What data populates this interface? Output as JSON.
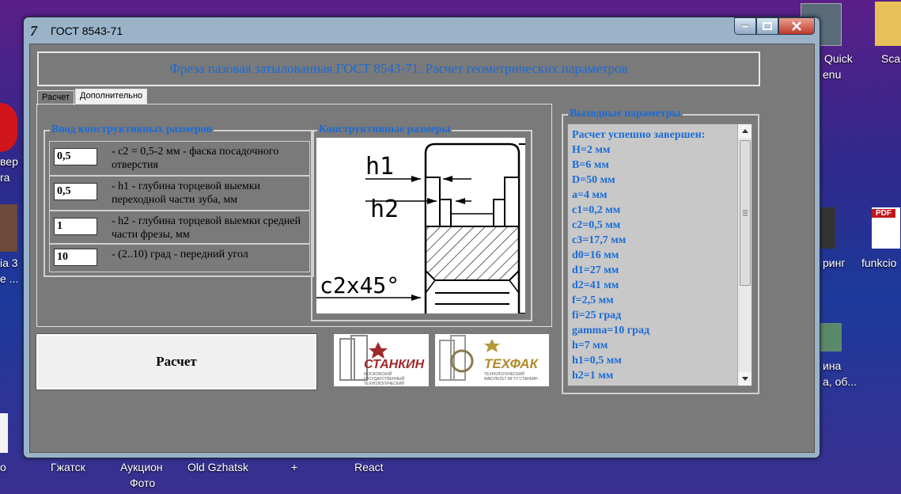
{
  "window": {
    "title": "ГОСТ 8543-71",
    "app_icon_glyph": "7",
    "header": "Фреза пазовая затылованная ГОСТ 8543-71. Расчет геометрических параметров"
  },
  "tabs": [
    {
      "label": "Расчет",
      "active": false
    },
    {
      "label": "Дополнительно",
      "active": true
    }
  ],
  "inputs_group": {
    "title": "Ввод конструктивных размеров",
    "rows": [
      {
        "value": "0,5",
        "desc": "- c2 = 0,5-2 мм - фаска посадочного отверстия"
      },
      {
        "value": "0,5",
        "desc": "- h1 - глубина торцевой выемки переходной части зуба, мм"
      },
      {
        "value": "1",
        "desc": "- h2 - глубина торцевой выемки средней части фрезы, мм"
      },
      {
        "value": "10",
        "desc": "- (2..10) град - передний угол"
      }
    ]
  },
  "drawing_group": {
    "title": "Конструктивные размеры",
    "labels": {
      "h1": "h1",
      "h2": "h2",
      "c2": "c2x45°"
    }
  },
  "calc_button": "Расчет",
  "logos": [
    {
      "name": "СТАНКИН",
      "sub": "МОСКОВСКИЙ ГОСУДАРСТВЕННЫЙ ТЕХНОЛОГИЧЕСКИЙ УНИВЕРСИТЕТ"
    },
    {
      "name": "ТЕХФАК",
      "sub": "ТЕХНОЛОГИЧЕСКИЙ ФАКУЛЬТЕТ МГТУ СТАНКИН"
    }
  ],
  "output_group": {
    "title": "Выходные параметры",
    "lines": [
      "Расчет успешно завершен:",
      "H=2 мм",
      "B=6 мм",
      "D=50 мм",
      "a=4 мм",
      "c1=0,2 мм",
      "c2=0,5 мм",
      "c3=17,7 мм",
      "d0=16 мм",
      "d1=27 мм",
      "d2=41 мм",
      "f=2,5 мм",
      "fi=25 град",
      "gamma=10 град",
      "h=7 мм",
      "h1=0,5 мм",
      "h2=1 мм"
    ]
  },
  "desktop": {
    "right_labels": [
      "Quick",
      "Sca",
      "enu",
      "ринг",
      "funkcio",
      "ина",
      "а, об..."
    ],
    "left_labels": [
      "вер",
      "ra",
      "ia 3",
      "e ...",
      "o"
    ],
    "taskbar_labels": [
      "Гжатск",
      "Аукцион",
      "Фото",
      "Old Gzhatsk",
      "+",
      "React"
    ],
    "pdf_badge": "PDF"
  },
  "colors": {
    "accent": "#1a6bd6",
    "client_bg": "#7a7a7a"
  }
}
